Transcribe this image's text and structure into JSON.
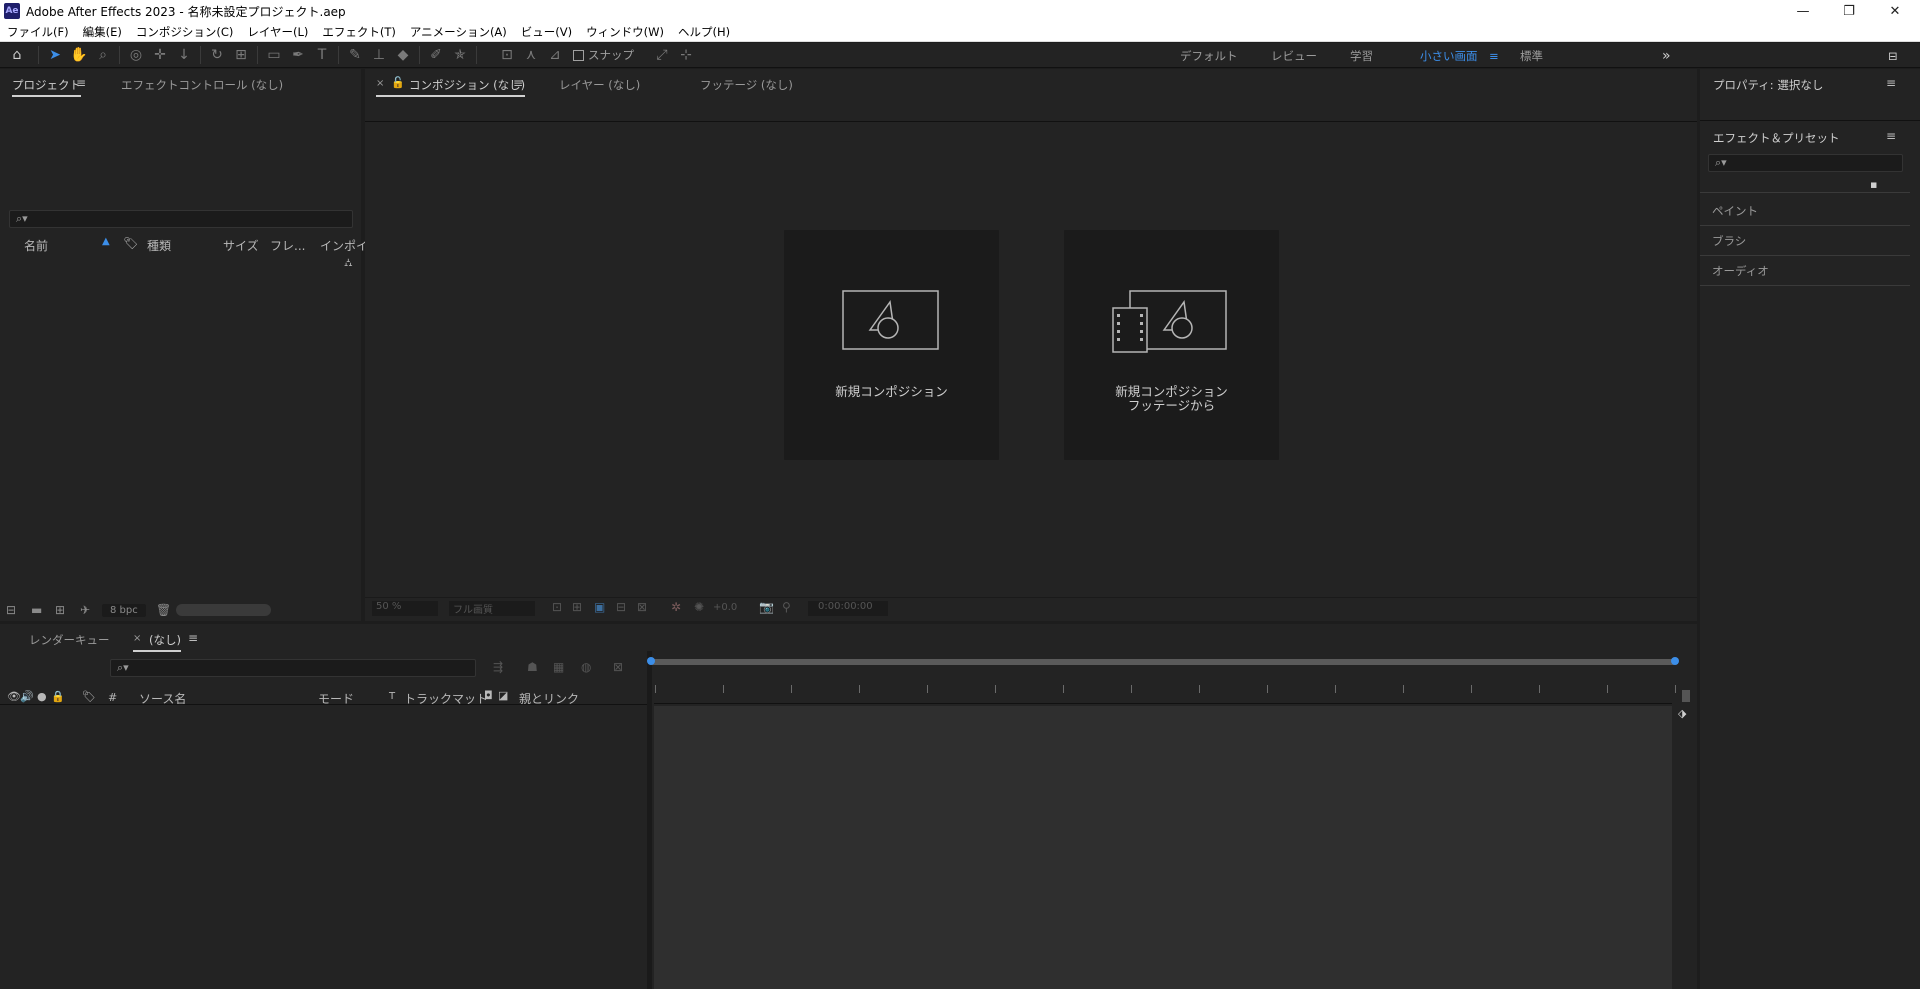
{
  "window": {
    "logo": "Ae",
    "title": "Adobe After Effects 2023 - 名称未設定プロジェクト.aep",
    "controls": [
      "minimize-icon",
      "restore-icon",
      "close-icon"
    ]
  },
  "menu": [
    "ファイル(F)",
    "編集(E)",
    "コンポジション(C)",
    "レイヤー(L)",
    "エフェクト(T)",
    "アニメーション(A)",
    "ビュー(V)",
    "ウィンドウ(W)",
    "ヘルプ(H)"
  ],
  "toolbar": {
    "snap_label": "スナップ",
    "workspaces": [
      "デフォルト",
      "レビュー",
      "学習",
      "小さい画面",
      "標準"
    ],
    "active_workspace": "小さい画面"
  },
  "project_panel": {
    "tab_project": "プロジェクト",
    "tab_effect_controls": "エフェクトコントロール (なし)",
    "columns": [
      "名前",
      "種類",
      "サイズ",
      "フレ...",
      "インポイ"
    ],
    "bpc": "8 bpc"
  },
  "comp_panel": {
    "tab_comp": "コンポジション (なし)",
    "tab_layer": "レイヤー (なし)",
    "tab_footage": "フッテージ (なし)",
    "new_comp_label": "新規コンポジション",
    "new_comp_footage_line1": "新規コンポジション",
    "new_comp_footage_line2": "フッテージから",
    "zoom": "50 %",
    "resolution": "フル画質",
    "exposure": "+0.0",
    "timecode": "0:00:00:00"
  },
  "right_panel": {
    "properties_title": "プロパティ: 選択なし",
    "effects_title": "エフェクト＆プリセット",
    "items": [
      "ペイント",
      "ブラシ",
      "オーディオ"
    ]
  },
  "timeline": {
    "tab_render_queue": "レンダーキュー",
    "tab_none": "(なし)",
    "columns": {
      "number": "#",
      "source": "ソース名",
      "mode": "モード",
      "t": "T",
      "track_matte": "トラックマット",
      "parent": "親とリンク"
    }
  }
}
